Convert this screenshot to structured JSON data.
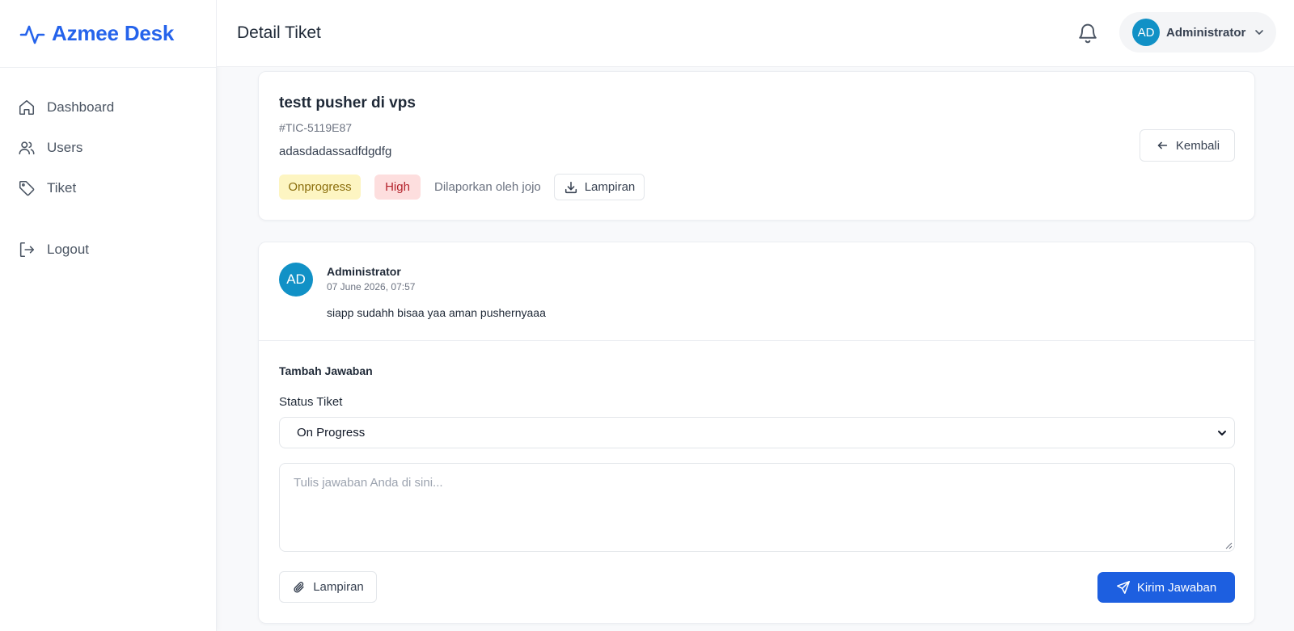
{
  "sidebar": {
    "brand": "Azmee Desk",
    "items": [
      {
        "label": "Dashboard",
        "icon": "home-icon"
      },
      {
        "label": "Users",
        "icon": "users-icon"
      },
      {
        "label": "Tiket",
        "icon": "tag-icon"
      }
    ],
    "logout_label": "Logout"
  },
  "header": {
    "title": "Detail Tiket",
    "user_initials": "AD",
    "user_name": "Administrator"
  },
  "ticket": {
    "title": "testt pusher di vps",
    "code": "#TIC-5119E87",
    "description": "adasdadassadfdgdfg",
    "status": "Onprogress",
    "priority": "High",
    "reported_by": "Dilaporkan oleh jojo",
    "attachment_label": "Lampiran",
    "back_label": "Kembali"
  },
  "replies": [
    {
      "initials": "AD",
      "author": "Administrator",
      "date": "07 June 2026, 07:57",
      "body": "siapp sudahh bisaa yaa aman pushernyaaa"
    }
  ],
  "form": {
    "section_title": "Tambah Jawaban",
    "status_label": "Status Tiket",
    "status_value": "On Progress",
    "placeholder": "Tulis jawaban Anda di sini...",
    "attach_label": "Lampiran",
    "submit_label": "Kirim Jawaban"
  },
  "colors": {
    "brand": "#2563eb",
    "avatar": "#1191c6",
    "primary_button": "#1d5fe0",
    "status_bg": "#fdf5c2",
    "priority_bg": "#fddede"
  }
}
